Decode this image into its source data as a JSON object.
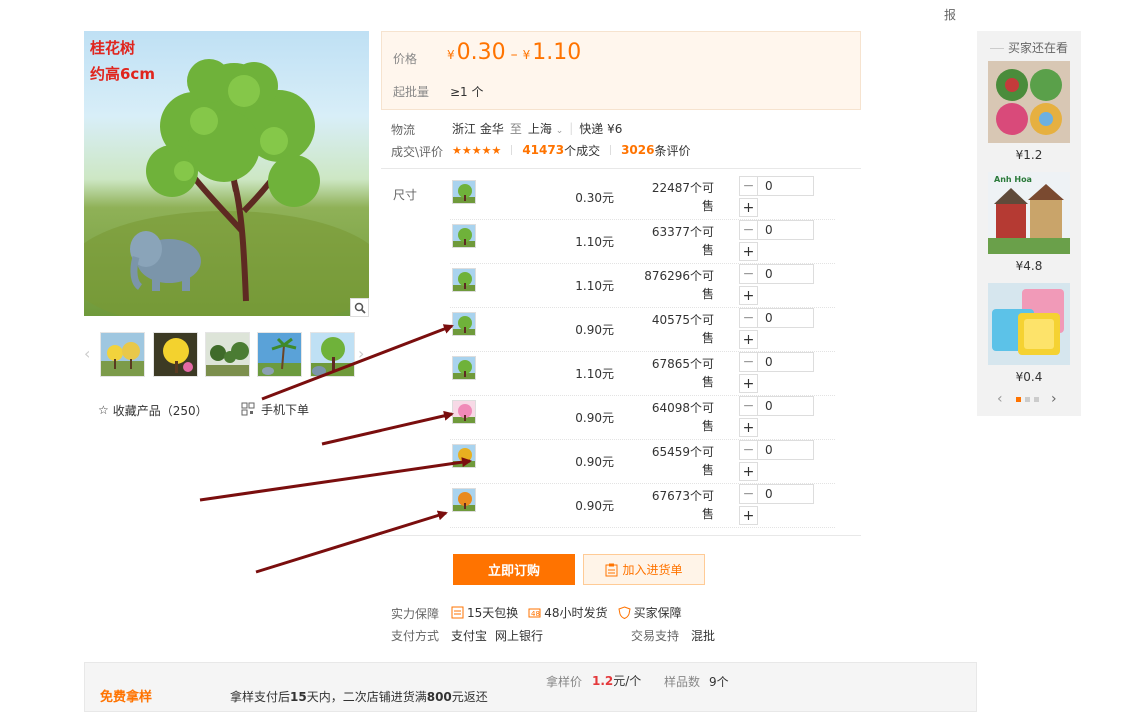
{
  "header": {
    "top_cut_text": "",
    "top_right_text": "报"
  },
  "gallery": {
    "main_image_caption_line1": "桂花树",
    "main_image_caption_line2": "约高6cm",
    "thumbnails": [
      "thumb-yellow-flower-trees",
      "thumb-yellow-tree",
      "thumb-bonsai-trees",
      "thumb-palm-tree",
      "thumb-green-tree-elephant"
    ],
    "favorite_label": "收藏产品（250）",
    "mobile_order_label": "手机下单"
  },
  "price": {
    "label": "价格",
    "currency": "¥",
    "min": "0.30",
    "max": "1.10",
    "moq_label": "起批量",
    "moq_value": "≥1 个"
  },
  "logistics": {
    "label": "物流",
    "origin": "浙江 金华",
    "to": "至",
    "destination": "上海",
    "shipping": "快递 ¥6"
  },
  "deals": {
    "label": "成交\\评价",
    "stars": "★★★★★",
    "deal_count": "41473",
    "deal_suffix": "个成交",
    "review_count": "3026",
    "review_suffix": "条评价"
  },
  "sku": {
    "label": "尺寸",
    "rows": [
      {
        "price": "0.30元",
        "stock_line1": "22487个可",
        "stock_line2": "售",
        "qty": "0",
        "thumb": "green-tree"
      },
      {
        "price": "1.10元",
        "stock_line1": "63377个可",
        "stock_line2": "售",
        "qty": "0",
        "thumb": "green-tree"
      },
      {
        "price": "1.10元",
        "stock_line1": "876296个可",
        "stock_line2": "售",
        "qty": "0",
        "thumb": "green-tree"
      },
      {
        "price": "0.90元",
        "stock_line1": "40575个可",
        "stock_line2": "售",
        "qty": "0",
        "thumb": "green-tree"
      },
      {
        "price": "1.10元",
        "stock_line1": "67865个可",
        "stock_line2": "售",
        "qty": "0",
        "thumb": "green-tree"
      },
      {
        "price": "0.90元",
        "stock_line1": "64098个可",
        "stock_line2": "售",
        "qty": "0",
        "thumb": "pink-tree"
      },
      {
        "price": "0.90元",
        "stock_line1": "65459个可",
        "stock_line2": "售",
        "qty": "0",
        "thumb": "yellow-tree"
      },
      {
        "price": "0.90元",
        "stock_line1": "67673个可",
        "stock_line2": "售",
        "qty": "0",
        "thumb": "orange-tree"
      }
    ],
    "minus": "−",
    "plus": "+"
  },
  "actions": {
    "buy_label": "立即订购",
    "cart_label": "加入进货单"
  },
  "guarantee": {
    "label": "实力保障",
    "items": [
      "15天包换",
      "48小时发货",
      "买家保障"
    ],
    "pay_label": "支付方式",
    "pay_methods": [
      "支付宝",
      "网上银行"
    ],
    "trade_label": "交易支持",
    "trade_value": "混批"
  },
  "sidebar": {
    "title": "买家还在看",
    "items": [
      {
        "price": "¥1.2"
      },
      {
        "price": "¥4.8"
      },
      {
        "price": "¥0.4"
      }
    ],
    "prev": "‹",
    "next": "›"
  },
  "sample": {
    "badge": "免费拿样",
    "text_prefix": "拿样支付后",
    "text_days": "15",
    "text_mid": "天内，二次店铺进货满",
    "text_amount": "800",
    "text_suffix": "元返还",
    "price_label": "拿样价",
    "price_value": "1.2",
    "price_unit": "元/个",
    "count_label": "样品数",
    "count_value": "9个"
  },
  "colors": {
    "accent": "#ff7300",
    "arrow": "#7a0e0e",
    "price_box_bg": "#fff6ed"
  }
}
